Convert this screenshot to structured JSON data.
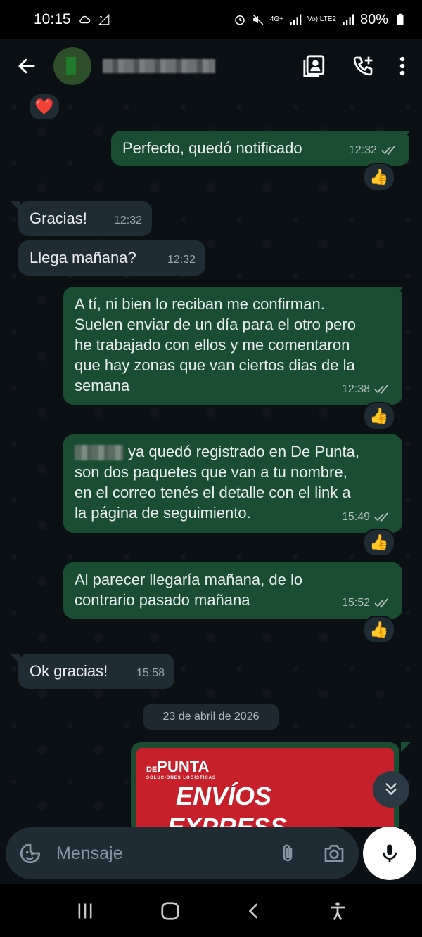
{
  "status_bar": {
    "time": "10:15",
    "signal_label_1": "4G+",
    "signal_label_2": "Vo) LTE2",
    "battery": "80%"
  },
  "header": {
    "back_icon": "arrow-left",
    "contact_name": "",
    "actions": [
      "contact-card-icon",
      "add-call-icon",
      "more-vert-icon"
    ]
  },
  "messages": [
    {
      "dir": "in",
      "reaction_only": "❤️"
    },
    {
      "dir": "out",
      "text": "Perfecto, quedó notificado",
      "time": "12:32",
      "reaction": "👍"
    },
    {
      "dir": "in",
      "text": "Gracias!",
      "time": "12:32"
    },
    {
      "dir": "in",
      "text": "Llega mañana?",
      "time": "12:32"
    },
    {
      "dir": "out",
      "text": "A tí, ni bien lo reciban me confirman.\nSuelen enviar de un día para el otro pero\nhe trabajado con ellos y me comentaron\nque hay zonas que van ciertos dias de la\nsemana",
      "time": "12:38",
      "reaction": "👍"
    },
    {
      "dir": "out",
      "text": "ya quedó registrado en De Punta,\nson dos paquetes que van a tu nombre,\nen el correo tenés el detalle con el link a\nla página de seguimiento.",
      "time": "15:49",
      "reaction": "👍"
    },
    {
      "dir": "out",
      "text": "Al parecer llegaría mañana, de lo\ncontrario pasado mañana",
      "time": "15:52",
      "reaction": "👍"
    },
    {
      "dir": "in",
      "text": "Ok gracias!",
      "time": "15:58"
    }
  ],
  "date_divider": "23 de abril de 2026",
  "image_message": {
    "brand": "PUNTA",
    "brand_prefix": "DE",
    "brand_tagline": "SOLUCIONES LOGÍSTICAS",
    "line1": "ENVÍOS",
    "line2": "EXPRESS"
  },
  "composer": {
    "placeholder": "Mensaje"
  },
  "colors": {
    "background": "#0b1014",
    "outgoing": "#1a4d32",
    "incoming": "#202c33",
    "image_red": "#c8202a"
  }
}
